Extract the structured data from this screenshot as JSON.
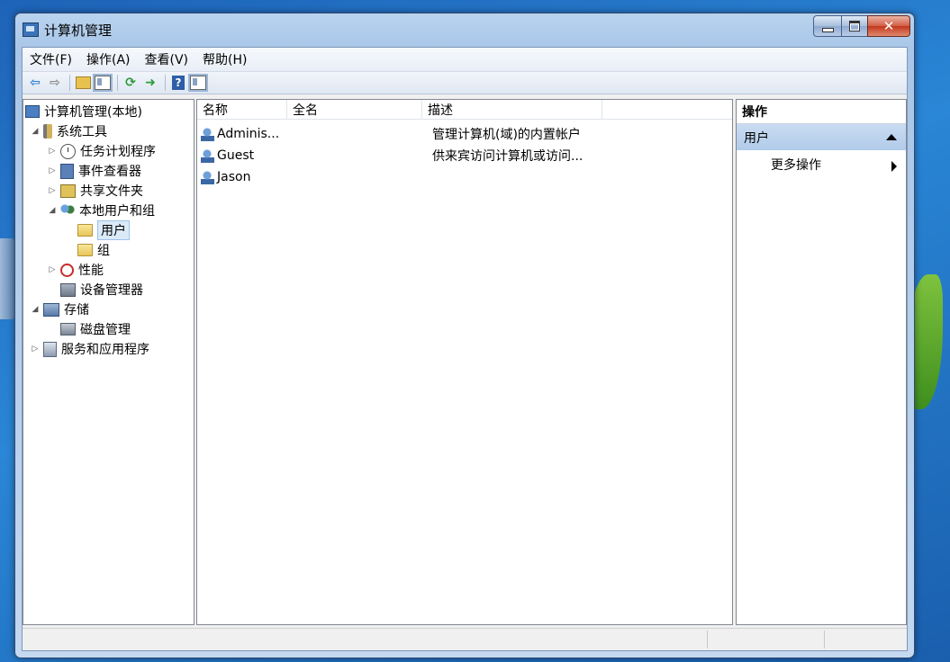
{
  "window": {
    "title": "计算机管理"
  },
  "menubar": {
    "items": [
      "文件(F)",
      "操作(A)",
      "查看(V)",
      "帮助(H)"
    ]
  },
  "toolbar": {
    "icons": [
      "back-arrow-icon",
      "forward-arrow-icon",
      "up-folder-icon",
      "show-tree-icon",
      "refresh-icon",
      "export-icon",
      "help-icon",
      "show-action-pane-icon"
    ]
  },
  "tree": {
    "root": "计算机管理(本地)",
    "system_tools": "系统工具",
    "task_scheduler": "任务计划程序",
    "event_viewer": "事件查看器",
    "shared_folders": "共享文件夹",
    "local_users_groups": "本地用户和组",
    "users": "用户",
    "groups": "组",
    "performance": "性能",
    "device_manager": "设备管理器",
    "storage": "存储",
    "disk_management": "磁盘管理",
    "services_apps": "服务和应用程序"
  },
  "list": {
    "columns": [
      "名称",
      "全名",
      "描述"
    ],
    "rows": [
      {
        "name": "Adminis...",
        "fullname": "",
        "description": "管理计算机(域)的内置帐户"
      },
      {
        "name": "Guest",
        "fullname": "",
        "description": "供来宾访问计算机或访问..."
      },
      {
        "name": "Jason",
        "fullname": "",
        "description": ""
      }
    ]
  },
  "actions": {
    "header": "操作",
    "group": "用户",
    "more": "更多操作"
  },
  "colors": {
    "selection_bg": "#dbeaf9",
    "action_group_bg": "#b1cbea",
    "window_frame": "#a9c6e8"
  }
}
